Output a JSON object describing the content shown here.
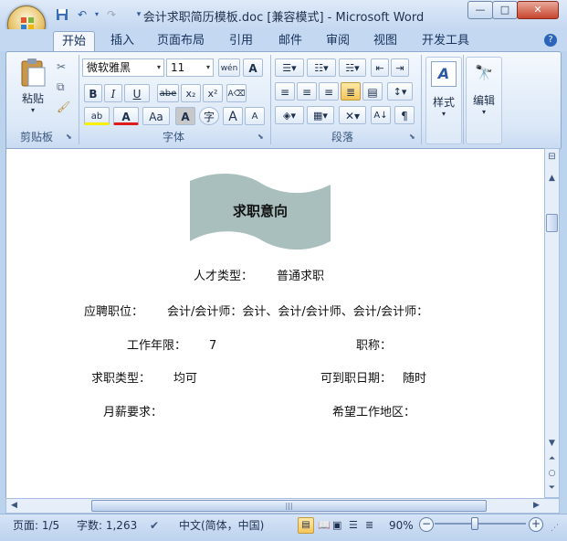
{
  "window": {
    "title": "会计求职简历模板.doc [兼容模式] - Microsoft Word",
    "minimize": "—",
    "maximize": "□",
    "close": "✕"
  },
  "tabs": [
    {
      "label": "开始",
      "active": true
    },
    {
      "label": "插入"
    },
    {
      "label": "页面布局"
    },
    {
      "label": "引用"
    },
    {
      "label": "邮件"
    },
    {
      "label": "审阅"
    },
    {
      "label": "视图"
    },
    {
      "label": "开发工具"
    }
  ],
  "ribbon": {
    "clipboard": {
      "label": "剪贴板",
      "paste": "粘贴"
    },
    "font": {
      "label": "字体",
      "name": "微软雅黑",
      "size": "11",
      "bold": "B",
      "italic": "I",
      "underline": "U",
      "strike": "abe",
      "sub": "x₂",
      "sup": "x²",
      "change_case": "Aa",
      "grow": "A",
      "shrink": "A"
    },
    "paragraph": {
      "label": "段落"
    },
    "styles": {
      "label": "样式"
    },
    "editing": {
      "label": "编辑"
    }
  },
  "document": {
    "banner": "求职意向",
    "rows": [
      {
        "label": "人才类型：",
        "value": "普通求职"
      },
      {
        "label": "应聘职位：",
        "value": "会计/会计师：会计、会计/会计师、会计/会计师："
      },
      {
        "label": "工作年限：",
        "value": "7",
        "label2": "职称：",
        "value2": ""
      },
      {
        "label": "求职类型：",
        "value": "均可",
        "label2": "可到职日期：",
        "value2": "随时"
      },
      {
        "label": "月薪要求：",
        "value": "",
        "label2": "希望工作地区：",
        "value2": ""
      }
    ]
  },
  "status": {
    "page": "页面: 1/5",
    "words": "字数: 1,263",
    "language": "中文(简体，中国)",
    "zoom": "90%",
    "zoom_level_percent": 90
  },
  "colors": {
    "accent": "#2b5aa3",
    "banner_fill": "#a9bfbd"
  }
}
